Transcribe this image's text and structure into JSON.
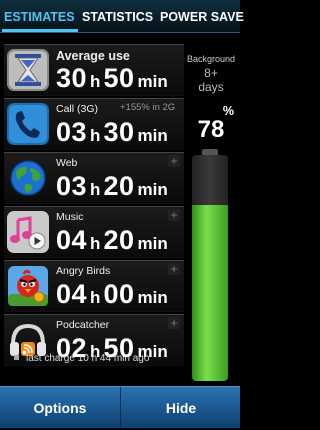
{
  "tabs": [
    {
      "label": "ESTIMATES",
      "active": true
    },
    {
      "label": "STATISTICS",
      "active": false
    },
    {
      "label": "POWER SAVE",
      "active": false
    }
  ],
  "average": {
    "label": "Average use",
    "hours": "30",
    "hours_unit": "h",
    "minutes": "50",
    "minutes_unit": "min",
    "icon": "hourglass-icon"
  },
  "items": [
    {
      "label": "Call (3G)",
      "delta": "+155% in 2G",
      "hours": "03",
      "minutes": "30",
      "icon": "phone-icon"
    },
    {
      "label": "Web",
      "hours": "03",
      "minutes": "20",
      "icon": "globe-icon"
    },
    {
      "label": "Music",
      "hours": "04",
      "minutes": "20",
      "icon": "music-icon"
    },
    {
      "label": "Angry Birds",
      "hours": "04",
      "minutes": "00",
      "icon": "angry-birds-icon"
    },
    {
      "label": "Podcatcher",
      "hours": "02",
      "minutes": "50",
      "icon": "podcast-icon"
    }
  ],
  "units": {
    "h": "h",
    "min": "min"
  },
  "background": {
    "label": "Background",
    "value": "8+",
    "unit": "days"
  },
  "battery": {
    "percent_label": "%",
    "percent": "78",
    "level": 0.78
  },
  "last_charge": "last charge 10 h 44 min ago",
  "buttons": {
    "options": "Options",
    "hide": "Hide"
  },
  "colors": {
    "accent": "#4fc7f2",
    "battery_green": "#5cc93a",
    "button_blue": "#1e5a92"
  }
}
